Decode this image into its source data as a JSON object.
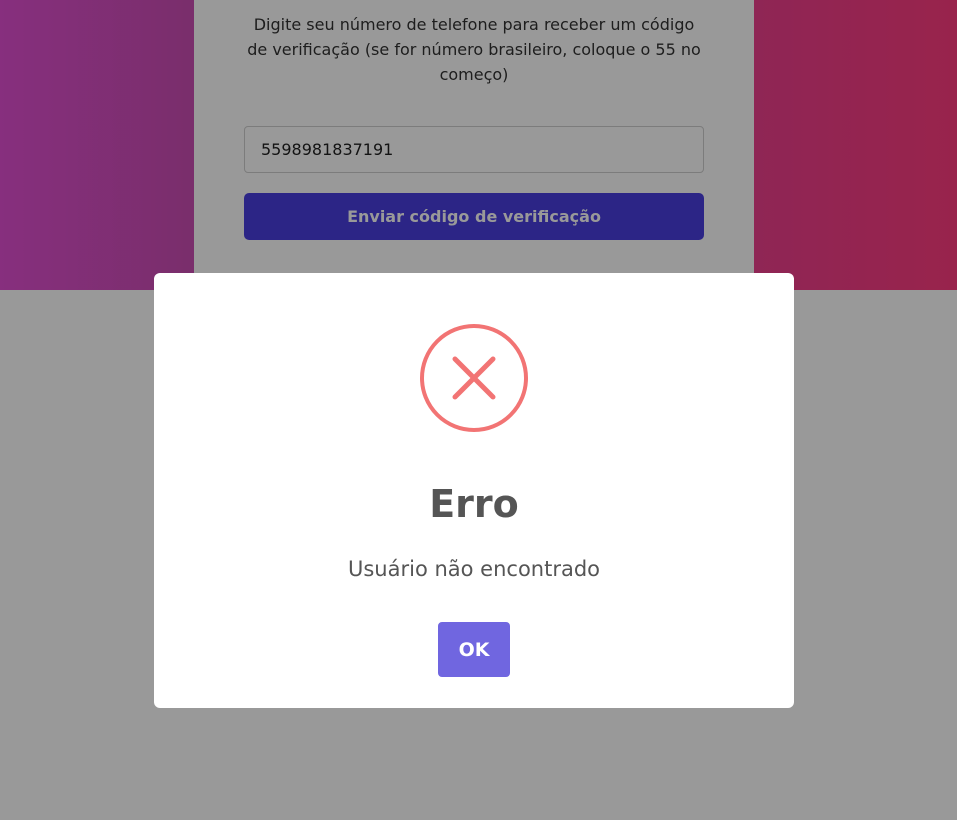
{
  "form": {
    "description": "Digite seu número de telefone para receber um código de verificação (se for número brasileiro, coloque o 55 no começo)",
    "phone_value": "5598981837191",
    "send_button_label": "Enviar código de verificação"
  },
  "dialog": {
    "icon": "error-x-icon",
    "title": "Erro",
    "message": "Usuário não encontrado",
    "ok_label": "OK"
  },
  "colors": {
    "gradient_left": "#e14fd2",
    "gradient_right": "#ff3b7f",
    "primary_button": "#4a3fe0",
    "error_icon": "#f27474",
    "dialog_confirm": "#7066e0"
  }
}
